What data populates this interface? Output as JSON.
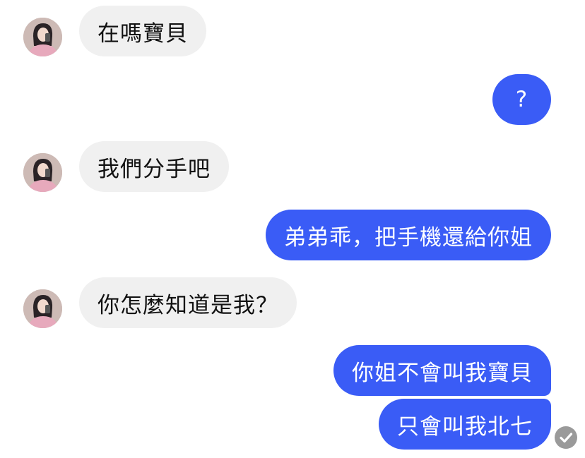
{
  "colors": {
    "incoming_bubble": "#f0f0f0",
    "outgoing_bubble": "#3a5cf6",
    "read_receipt": "#9a9a9a"
  },
  "messages": [
    {
      "direction": "incoming",
      "text": "在嗎寶貝"
    },
    {
      "direction": "outgoing",
      "text": "?"
    },
    {
      "direction": "incoming",
      "text": "我們分手吧"
    },
    {
      "direction": "outgoing",
      "text": "弟弟乖，把手機還給你姐"
    },
    {
      "direction": "incoming",
      "text": "你怎麼知道是我？"
    },
    {
      "direction": "outgoing",
      "text": "你姐不會叫我寶貝"
    },
    {
      "direction": "outgoing",
      "text": "只會叫我北七"
    }
  ],
  "icons": {
    "avatar": "contact-avatar-photo",
    "receipt": "read-checkmark-icon"
  }
}
